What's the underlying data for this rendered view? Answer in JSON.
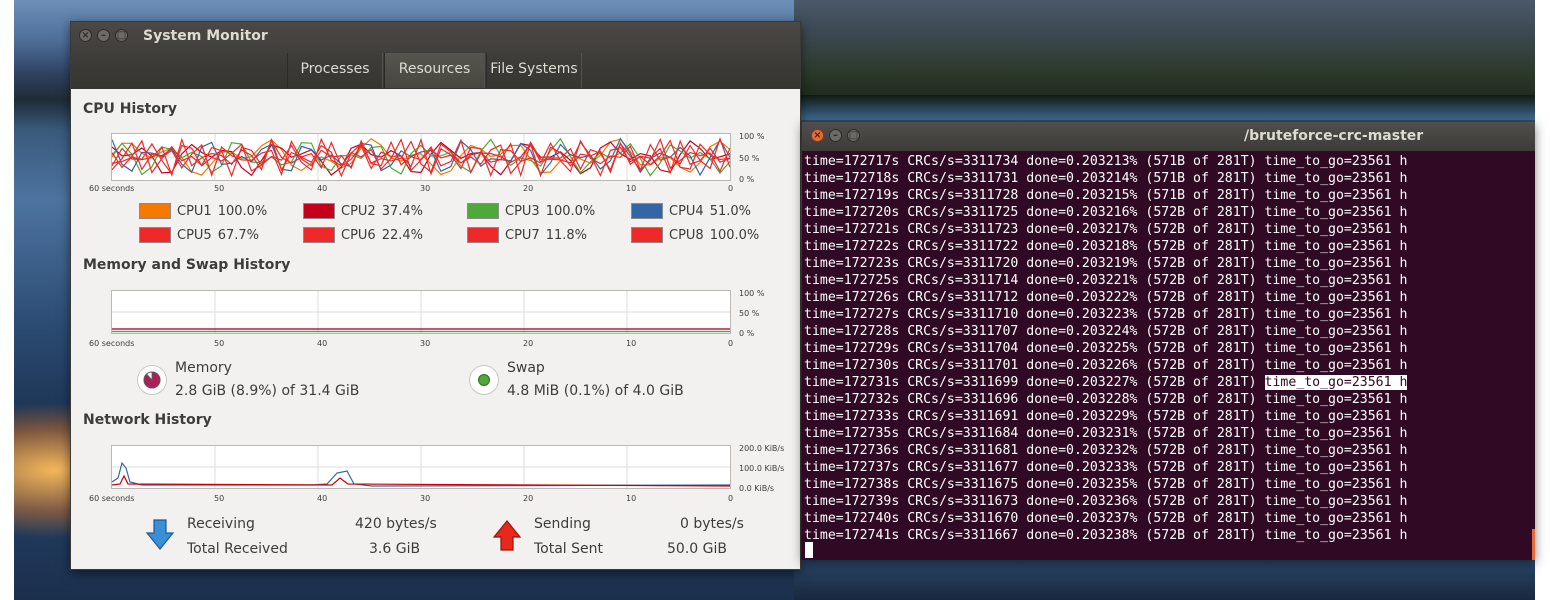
{
  "system_monitor": {
    "title": "System Monitor",
    "tabs": [
      {
        "label": "Processes",
        "active": false
      },
      {
        "label": "Resources",
        "active": true
      },
      {
        "label": "File Systems",
        "active": false
      }
    ],
    "time_axis": [
      "60 seconds",
      "50",
      "40",
      "30",
      "20",
      "10",
      "0"
    ],
    "cpu": {
      "title": "CPU History",
      "y_axis": [
        "100 %",
        "50 %",
        "0 %"
      ],
      "cores": [
        {
          "name": "CPU1",
          "percent": "100.0%",
          "color": "#f57900"
        },
        {
          "name": "CPU2",
          "percent": "37.4%",
          "color": "#c4001c"
        },
        {
          "name": "CPU3",
          "percent": "100.0%",
          "color": "#4ea83a"
        },
        {
          "name": "CPU4",
          "percent": "51.0%",
          "color": "#3465a4"
        },
        {
          "name": "CPU5",
          "percent": "67.7%",
          "color": "#ef2929"
        },
        {
          "name": "CPU6",
          "percent": "22.4%",
          "color": "#ef2929"
        },
        {
          "name": "CPU7",
          "percent": "11.8%",
          "color": "#ef2929"
        },
        {
          "name": "CPU8",
          "percent": "100.0%",
          "color": "#ef2929"
        }
      ]
    },
    "memory": {
      "title": "Memory and Swap History",
      "y_axis": [
        "100 %",
        "50 %",
        "0 %"
      ],
      "memory_label": "Memory",
      "memory_value": "2.8 GiB (8.9%) of 31.4 GiB",
      "memory_color": "#ad1f5a",
      "swap_label": "Swap",
      "swap_value": "4.8 MiB (0.1%) of 4.0 GiB",
      "swap_color": "#4ea83a"
    },
    "network": {
      "title": "Network History",
      "y_axis": [
        "200.0 KiB/s",
        "100.0 KiB/s",
        "0.0 KiB/s"
      ],
      "receiving_label": "Receiving",
      "receiving_value": "420 bytes/s",
      "total_received_label": "Total Received",
      "total_received_value": "3.6 GiB",
      "sending_label": "Sending",
      "sending_value": "0 bytes/s",
      "total_sent_label": "Total Sent",
      "total_sent_value": "50.0 GiB",
      "receive_color": "#3465a4",
      "send_color": "#cc0000"
    }
  },
  "terminal": {
    "title": "/bruteforce-crc-master",
    "lines": [
      "time=172717s CRCs/s=3311734 done=0.203213% (571B of 281T) time_to_go=23561 h",
      "time=172718s CRCs/s=3311731 done=0.203214% (571B of 281T) time_to_go=23561 h",
      "time=172719s CRCs/s=3311728 done=0.203215% (571B of 281T) time_to_go=23561 h",
      "time=172720s CRCs/s=3311725 done=0.203216% (572B of 281T) time_to_go=23561 h",
      "time=172721s CRCs/s=3311723 done=0.203217% (572B of 281T) time_to_go=23561 h",
      "time=172722s CRCs/s=3311722 done=0.203218% (572B of 281T) time_to_go=23561 h",
      "time=172723s CRCs/s=3311720 done=0.203219% (572B of 281T) time_to_go=23561 h",
      "time=172725s CRCs/s=3311714 done=0.203221% (572B of 281T) time_to_go=23561 h",
      "time=172726s CRCs/s=3311712 done=0.203222% (572B of 281T) time_to_go=23561 h",
      "time=172727s CRCs/s=3311710 done=0.203223% (572B of 281T) time_to_go=23561 h",
      "time=172728s CRCs/s=3311707 done=0.203224% (572B of 281T) time_to_go=23561 h",
      "time=172729s CRCs/s=3311704 done=0.203225% (572B of 281T) time_to_go=23561 h",
      "time=172730s CRCs/s=3311701 done=0.203226% (572B of 281T) time_to_go=23561 h",
      "time=172731s CRCs/s=3311699 done=0.203227% (572B of 281T) time_to_go=23561 h",
      "time=172732s CRCs/s=3311696 done=0.203228% (572B of 281T) time_to_go=23561 h",
      "time=172733s CRCs/s=3311691 done=0.203229% (572B of 281T) time_to_go=23561 h",
      "time=172735s CRCs/s=3311684 done=0.203231% (572B of 281T) time_to_go=23561 h",
      "time=172736s CRCs/s=3311681 done=0.203232% (572B of 281T) time_to_go=23561 h",
      "time=172737s CRCs/s=3311677 done=0.203233% (572B of 281T) time_to_go=23561 h",
      "time=172738s CRCs/s=3311675 done=0.203235% (572B of 281T) time_to_go=23561 h",
      "time=172739s CRCs/s=3311673 done=0.203236% (572B of 281T) time_to_go=23561 h",
      "time=172740s CRCs/s=3311670 done=0.203237% (572B of 281T) time_to_go=23561 h",
      "time=172741s CRCs/s=3311667 done=0.203238% (572B of 281T) time_to_go=23561 h"
    ],
    "highlighted_line": 13,
    "highlighted_text": "time_to_go=23561 h"
  }
}
